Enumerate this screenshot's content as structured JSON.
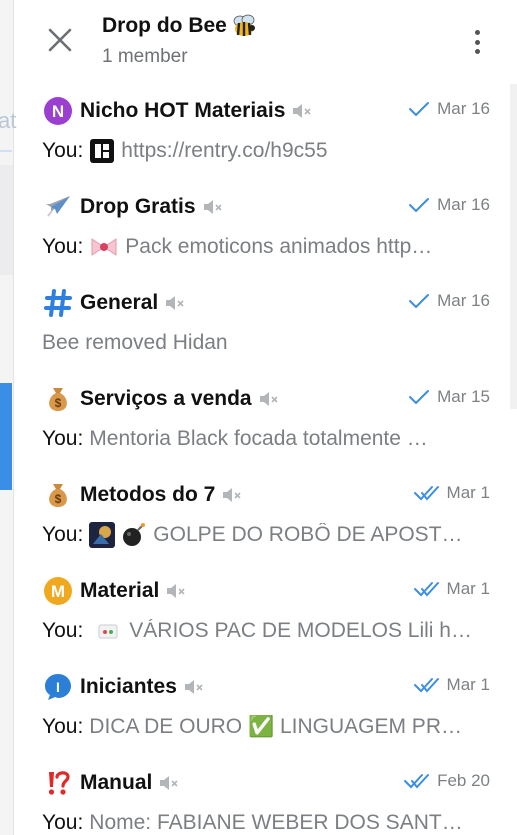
{
  "header": {
    "title": "Drop do Bee",
    "subtitle": "1 member"
  },
  "chats": [
    {
      "icon": "n-circle-icon",
      "name": "Nicho HOT Materiais",
      "date": "Mar 16",
      "read": "single",
      "you": "You:",
      "message": "https://rentry.co/h9c55"
    },
    {
      "icon": "airplane-icon",
      "name": "Drop Gratis",
      "date": "Mar 16",
      "read": "single",
      "you": "You:",
      "message": "Pack emoticons animados http…"
    },
    {
      "icon": "hash-icon",
      "name": "General",
      "date": "Mar 16",
      "read": "single",
      "you": "",
      "message": "Bee removed Hidan"
    },
    {
      "icon": "money-bag-icon",
      "name": "Serviços a venda",
      "date": "Mar 15",
      "read": "single",
      "you": "You:",
      "message": "Mentoria Black focada totalmente …"
    },
    {
      "icon": "money-bag-icon",
      "name": "Metodos do 7",
      "date": "Mar 1",
      "read": "double",
      "you": "You:",
      "message": "GOLPE DO ROBÔ DE APOST…"
    },
    {
      "icon": "m-circle-icon",
      "name": "Material",
      "date": "Mar 1",
      "read": "double",
      "you": "You:",
      "message": "VÁRIOS PAC DE MODELOS Lili h…"
    },
    {
      "icon": "info-bubble-icon",
      "name": "Iniciantes",
      "date": "Mar 1",
      "read": "double",
      "you": "You:",
      "message": "DICA DE OURO ✅ LINGUAGEM PR…"
    },
    {
      "icon": "exclamation-question-icon",
      "name": "Manual",
      "date": "Feb 20",
      "read": "double",
      "you": "You:",
      "message": "Nome: FABIANE WEBER DOS SANT…"
    }
  ],
  "colors": {
    "accent": "#3a8ee6",
    "date": "#7d8185",
    "preview": "#7b7f83"
  }
}
